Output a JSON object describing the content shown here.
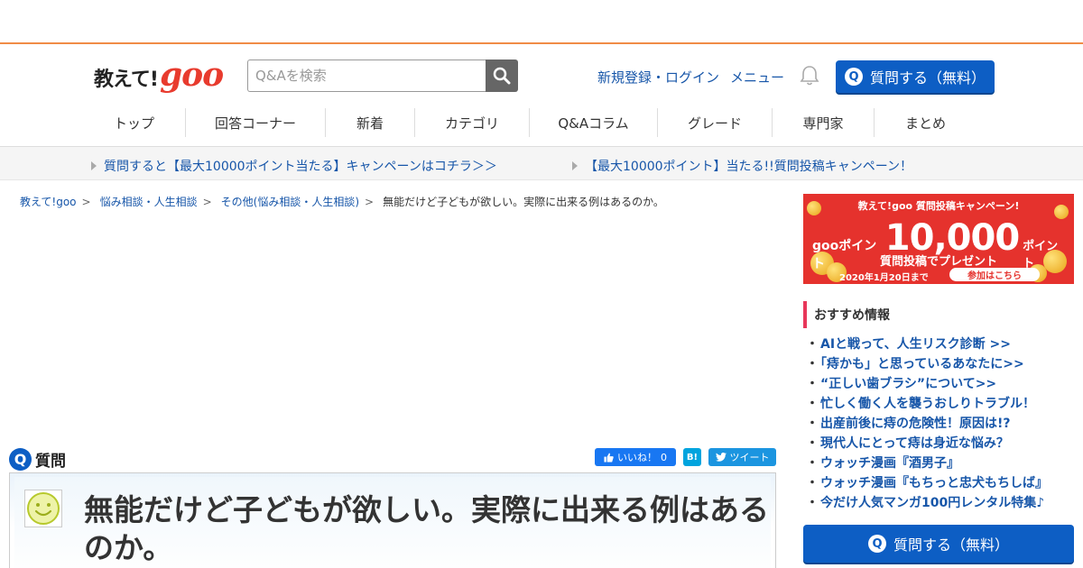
{
  "header": {
    "logo_jp": "教えて!",
    "logo_goo": "goo",
    "search_placeholder": "Q&Aを検索",
    "register_login": "新規登録・ログイン",
    "menu": "メニュー",
    "ask_button": "質問する（無料）",
    "q_glyph": "Q"
  },
  "nav": {
    "items": [
      "トップ",
      "回答コーナー",
      "新着",
      "カテゴリ",
      "Q&Aコラム",
      "グレード",
      "専門家",
      "まとめ"
    ]
  },
  "campaign": {
    "link1": "質問すると【最大10000ポイント当たる】キャンペーンはコチラ＞＞",
    "link2": "【最大10000ポイント】当たる!!質問投稿キャンペーン！"
  },
  "breadcrumb": {
    "items": [
      "教えて!goo",
      "悩み相談・人生相談",
      "その他(悩み相談・人生相談)"
    ],
    "sep": ">",
    "current": "無能だけど子どもが欲しい。実際に出来る例はあるのか。"
  },
  "question": {
    "label": "質問",
    "q_glyph": "Q",
    "title": "無能だけど子どもが欲しい。実際に出来る例はあるのか。",
    "like_label": "いいね！",
    "like_count": "0",
    "hatena_label": "B!",
    "tweet_label": "ツイート"
  },
  "sidebar": {
    "banner": {
      "heading": "教えて!goo 質問投稿キャンペーン!",
      "goo_points": "gooポイント",
      "amount": "10,000",
      "unit": "ポイント",
      "sub": "質問投稿でプレゼント",
      "date": "2020年1月20日まで",
      "cta": "参加はこちら"
    },
    "rec_heading": "おすすめ情報",
    "rec_items": [
      "AIと戦って、人生リスク診断 >>",
      "「痔かも」と思っているあなたに>>",
      "“正しい歯ブラシ”について>>",
      "忙しく働く人を襲うおしりトラブル！",
      "出産前後に痔の危険性！原因は!?",
      "現代人にとって痔は身近な悩み？",
      "ウォッチ漫画『酒男子』",
      "ウォッチ漫画『もちっと忠犬もちしば』",
      "今だけ人気マンガ100円レンタル特集♪"
    ],
    "rec_bullet": "・",
    "ask_button": "質問する（無料）"
  },
  "colors": {
    "accent_orange": "#f08c46",
    "link_blue": "#1756a9",
    "button_blue": "#0d5ec4",
    "goo_red": "#e83b2e"
  }
}
